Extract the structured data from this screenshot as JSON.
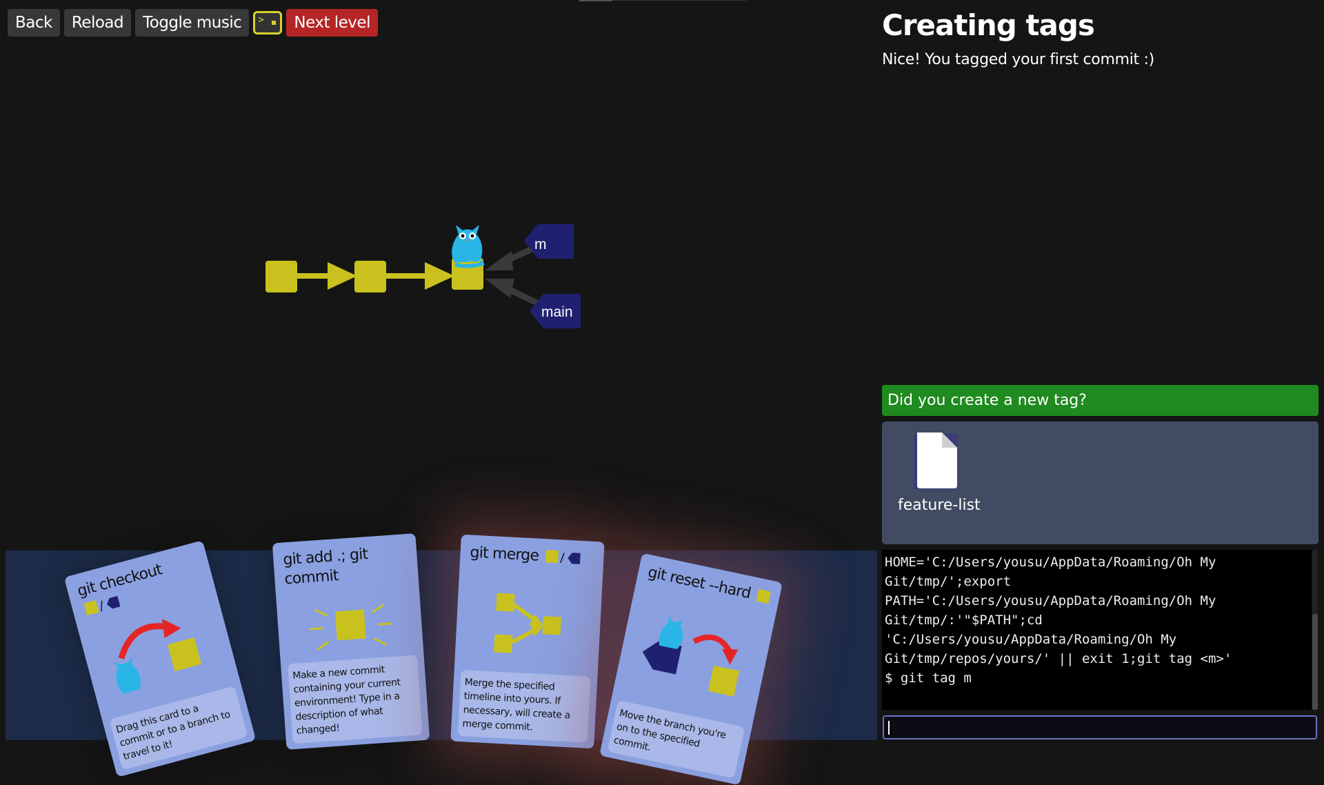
{
  "toolbar": {
    "back_label": "Back",
    "reload_label": "Reload",
    "music_label": "Toggle music",
    "terminal_icon": "terminal-icon",
    "next_label": "Next level",
    "next_color": "#b52525"
  },
  "graph": {
    "branch_m": "m",
    "branch_main": "main",
    "commit_color": "#c9c21e",
    "branch_color": "#1f2170",
    "head_icon": "owl-icon"
  },
  "level": {
    "title": "Creating tags",
    "description": "Nice! You tagged your first commit :)"
  },
  "goal": {
    "label": "Did you create a new tag?",
    "color": "#1f8a1f"
  },
  "files": [
    {
      "name": "feature-list",
      "icon": "file-icon"
    }
  ],
  "terminal": {
    "lines": [
      "HOME='C:/Users/yousu/AppData/Roaming/Oh My",
      "Git/tmp/';export",
      "PATH='C:/Users/yousu/AppData/Roaming/Oh My",
      "Git/tmp/:'\"$PATH\";cd",
      "'C:/Users/yousu/AppData/Roaming/Oh My",
      "Git/tmp/repos/yours/' || exit 1;git tag <m>'",
      "$ git tag m"
    ],
    "input_value": ""
  },
  "cards": [
    {
      "title": "git checkout",
      "description": "Drag this card to a commit or to a branch to travel to it!"
    },
    {
      "title": "git add .; git commit",
      "description": "Make a new commit containing your current environment! Type in a description of what changed!"
    },
    {
      "title": "git merge",
      "description": "Merge the specified timeline into yours. If necessary, will create a merge commit."
    },
    {
      "title": "git reset --hard",
      "description": "Move the branch you're on to the specified commit."
    }
  ]
}
